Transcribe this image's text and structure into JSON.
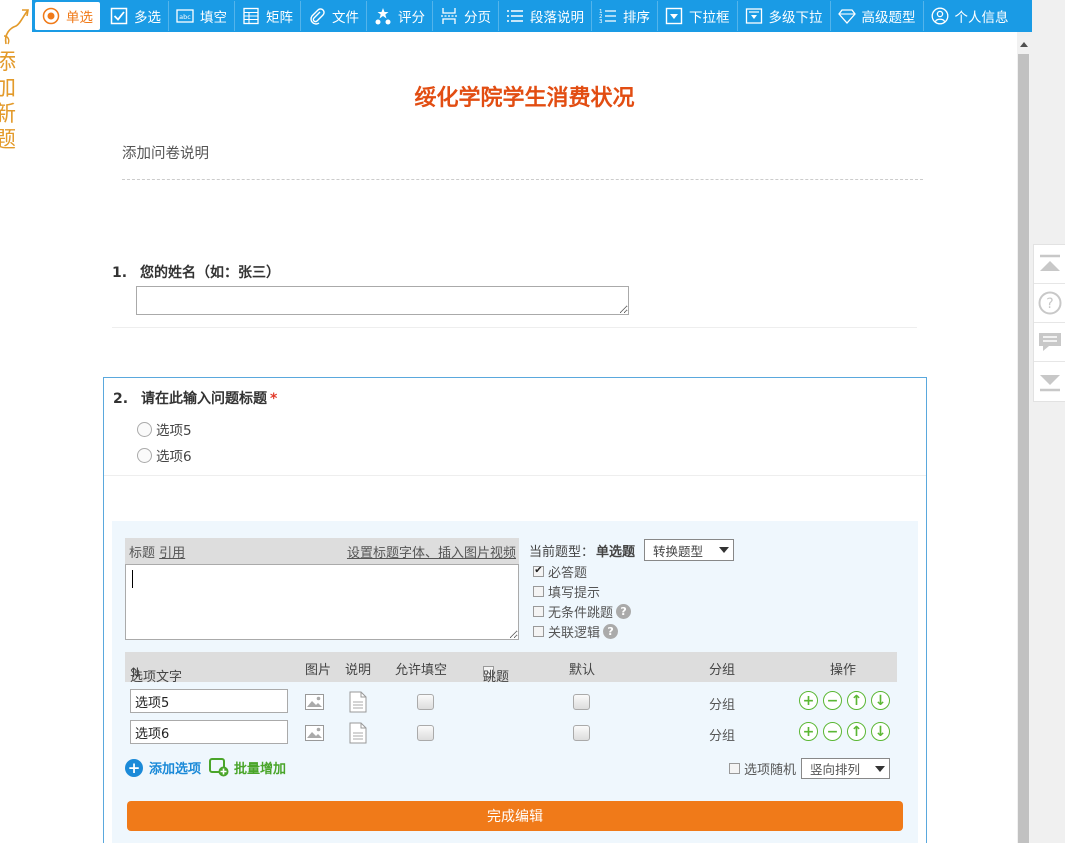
{
  "toolbar": {
    "items": [
      {
        "label": "单选",
        "icon": "radio-icon",
        "active": true
      },
      {
        "label": "多选",
        "icon": "checkbox-icon"
      },
      {
        "label": "填空",
        "icon": "abc-icon"
      },
      {
        "label": "矩阵",
        "icon": "matrix-icon"
      },
      {
        "label": "文件",
        "icon": "paperclip-icon"
      },
      {
        "label": "评分",
        "icon": "stars-icon"
      },
      {
        "label": "分页",
        "icon": "page-break-icon"
      },
      {
        "label": "段落说明",
        "icon": "paragraph-icon"
      },
      {
        "label": "排序",
        "icon": "sort-icon"
      },
      {
        "label": "下拉框",
        "icon": "dropdown-icon"
      },
      {
        "label": "多级下拉",
        "icon": "multilevel-dropdown-icon"
      },
      {
        "label": "高级题型",
        "icon": "diamond-icon"
      },
      {
        "label": "个人信息",
        "icon": "person-icon"
      }
    ],
    "active_color": "#f07a19",
    "bar_color": "#1a9be5"
  },
  "survey": {
    "title": "绥化学院学生消费状况",
    "description": "添加问卷说明",
    "title_color": "#e24d12"
  },
  "q1": {
    "number": "1.",
    "title": "您的姓名（如：张三）"
  },
  "q2": {
    "number": "2.",
    "title": "请在此输入问题标题",
    "required_mark": "*",
    "options": [
      "选项5",
      "选项6"
    ]
  },
  "editor": {
    "title_label": "标题",
    "quote_link": "引用",
    "font_link": "设置标题字体、插入图片视频",
    "current_type_label": "当前题型：",
    "current_type_value": "单选题",
    "convert_select": "转换题型",
    "checkboxes": [
      {
        "label": "必答题",
        "checked": true,
        "help": false
      },
      {
        "label": "填写提示",
        "checked": false,
        "help": false
      },
      {
        "label": "无条件跳题",
        "checked": false,
        "help": true
      },
      {
        "label": "关联逻辑",
        "checked": false,
        "help": true
      }
    ],
    "columns": {
      "option_text": "选项文字",
      "image": "图片",
      "note": "说明",
      "allow_fill": "允许填空",
      "jump": "跳题",
      "default": "默认",
      "group": "分组",
      "action": "操作"
    },
    "rows": [
      {
        "value": "选项5",
        "group": "分组"
      },
      {
        "value": "选项6",
        "group": "分组"
      }
    ],
    "add_option": "添加选项",
    "batch_add": "批量增加",
    "random_label": "选项随机",
    "layout_select": "竖向排列",
    "done_button": "完成编辑",
    "done_color": "#f07a19"
  },
  "decoration": {
    "text": [
      "添",
      "加",
      "新",
      "题"
    ]
  }
}
